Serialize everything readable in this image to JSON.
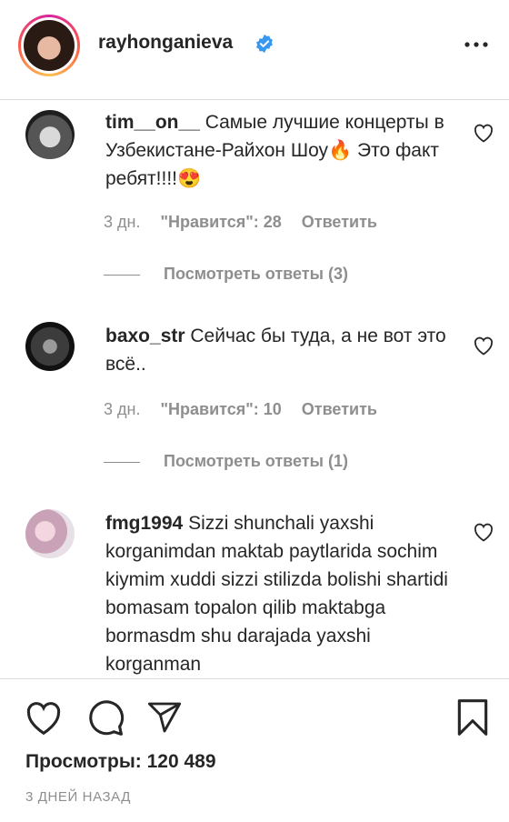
{
  "post": {
    "author": "rayhonganieva",
    "views_label": "Просмотры: 120 489",
    "date": "3 ДНЕЙ НАЗАД"
  },
  "comments": [
    {
      "username": "tim__on__",
      "text": "Самые лучшие концерты в Узбекистане-Райхон Шоу🔥 Это факт ребят!!!!😍",
      "time": "3 дн.",
      "likes": "\"Нравится\": 28",
      "reply": "Ответить",
      "view_replies": "Посмотреть ответы (3)"
    },
    {
      "username": "baxo_str",
      "text": "Сейчас бы туда, а не вот это всё..",
      "time": "3 дн.",
      "likes": "\"Нравится\": 10",
      "reply": "Ответить",
      "view_replies": "Посмотреть ответы (1)"
    },
    {
      "username": "fmg1994",
      "text": "Sizzi shunchali yaxshi korganimdan maktab paytlarida sochim kiymim xuddi sizzi stilizda bolishi shartidi bomasam topalon qilib maktabga bormasdm shu darajada yaxshi korganman"
    }
  ],
  "icons": {
    "verified": "verified-badge-icon",
    "more": "more-options-icon",
    "like": "heart-icon",
    "comment": "comment-icon",
    "share": "share-icon",
    "save": "bookmark-icon"
  },
  "colors": {
    "verified_blue": "#3897f0",
    "text": "#262626",
    "muted": "#8e8e8e",
    "divider": "#dbdbdb"
  }
}
